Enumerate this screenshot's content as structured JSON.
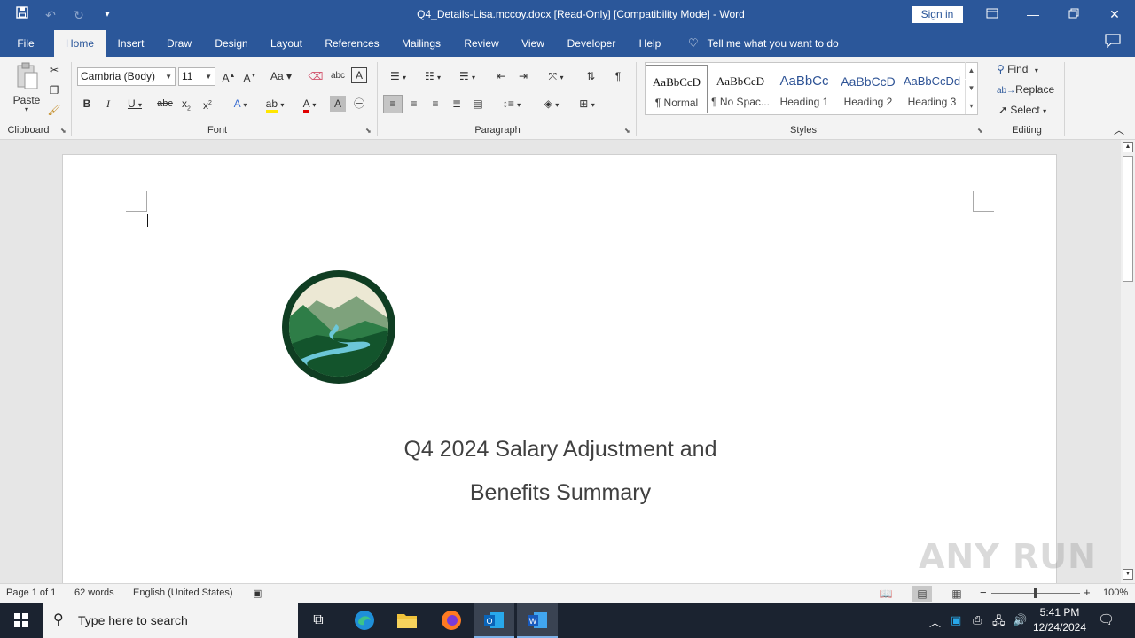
{
  "window": {
    "title": "Q4_Details-Lisa.mccoy.docx [Read-Only] [Compatibility Mode]  -  Word",
    "sign_in": "Sign in"
  },
  "tabs": [
    "File",
    "Home",
    "Insert",
    "Draw",
    "Design",
    "Layout",
    "References",
    "Mailings",
    "Review",
    "View",
    "Developer",
    "Help"
  ],
  "active_tab": "Home",
  "tell_me": "Tell me what you want to do",
  "ribbon": {
    "clipboard": {
      "paste": "Paste",
      "label": "Clipboard"
    },
    "font": {
      "name": "Cambria (Body)",
      "size": "11",
      "label": "Font"
    },
    "paragraph": {
      "label": "Paragraph"
    },
    "styles": {
      "label": "Styles",
      "items": [
        {
          "sample": "AaBbCcD",
          "name": "¶ Normal"
        },
        {
          "sample": "AaBbCcD",
          "name": "¶ No Spac..."
        },
        {
          "sample": "AaBbCc",
          "name": "Heading 1"
        },
        {
          "sample": "AaBbCcD",
          "name": "Heading 2"
        },
        {
          "sample": "AaBbCcDd",
          "name": "Heading 3"
        }
      ]
    },
    "editing": {
      "find": "Find",
      "replace": "Replace",
      "select": "Select",
      "label": "Editing"
    }
  },
  "document": {
    "title_line1": "Q4 2024 Salary Adjustment and",
    "title_line2": "Benefits Summary"
  },
  "status": {
    "page": "Page 1 of 1",
    "words": "62 words",
    "language": "English (United States)",
    "zoom": "100%",
    "zoom_minus": "−",
    "zoom_plus": "+"
  },
  "taskbar": {
    "search_placeholder": "Type here to search",
    "time": "5:41 PM",
    "date": "12/24/2024"
  },
  "watermark": "ANY RUN",
  "colors": {
    "word_blue": "#2b579a",
    "logo_dark_green": "#0f3d22",
    "logo_river": "#6cc7d8"
  }
}
